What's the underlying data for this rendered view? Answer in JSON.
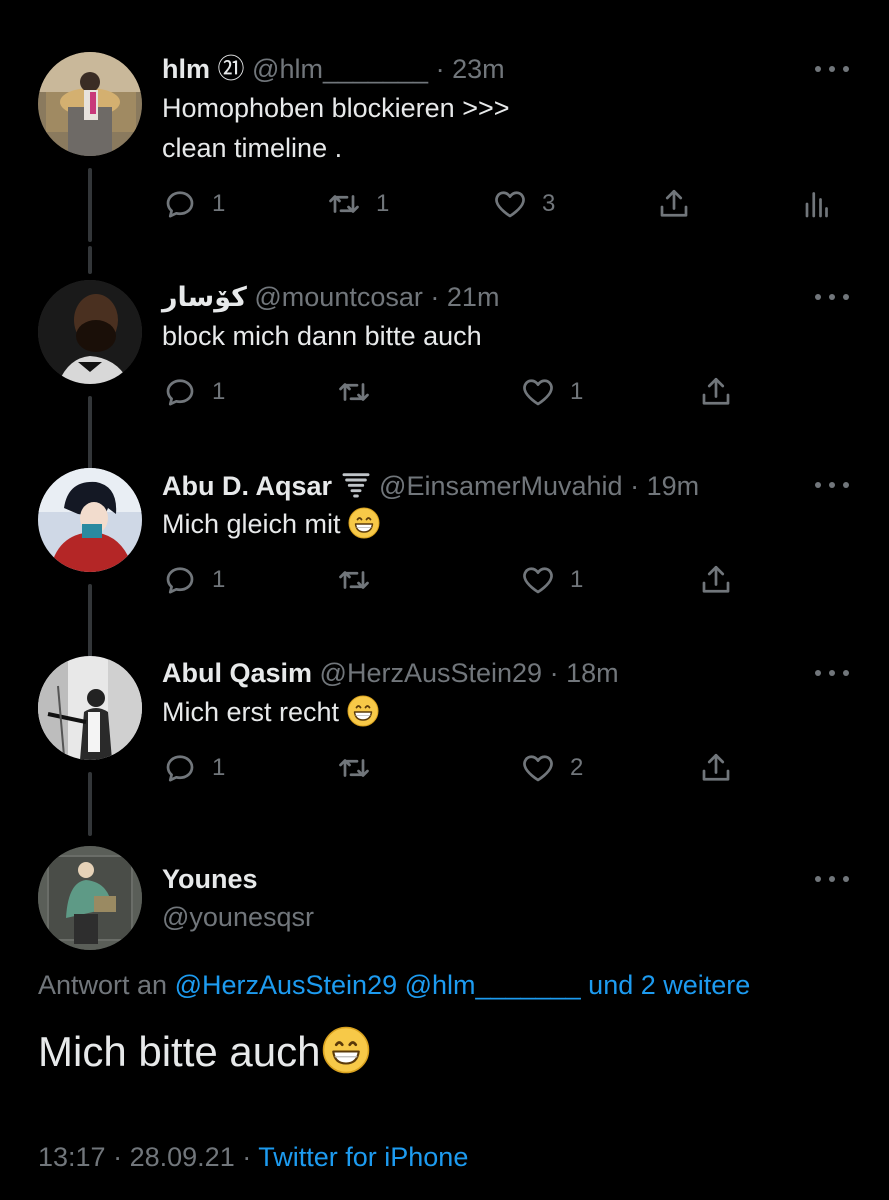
{
  "tweets": [
    {
      "name": "hlm",
      "badge": "㉑",
      "handle": "@hlm_______",
      "time": "23m",
      "text_lines": [
        "Homophoben blockieren >>>",
        "clean timeline ."
      ],
      "replies": "1",
      "retweets": "1",
      "likes": "3"
    },
    {
      "name": "كۆسار",
      "handle": "@mountcosar",
      "time": "21m",
      "text": "block mich dann bitte auch",
      "replies": "1",
      "retweets": "",
      "likes": "1"
    },
    {
      "name": "Abu D. Aqsar",
      "handle": "@EinsamerMuvahid",
      "time": "19m",
      "text": "Mich gleich mit",
      "replies": "1",
      "retweets": "",
      "likes": "1"
    },
    {
      "name": "Abul Qasim",
      "handle": "@HerzAusStein29",
      "time": "18m",
      "text": "Mich erst recht",
      "replies": "1",
      "retweets": "",
      "likes": "2"
    }
  ],
  "main_tweet": {
    "name": "Younes",
    "handle": "@younesqsr",
    "reply_prefix": "Antwort an",
    "reply_to_1": "@HerzAusStein29",
    "reply_to_2": "@hlm_______",
    "reply_more": "und 2 weitere",
    "text": "Mich bitte auch",
    "time": "13:17",
    "date": "28.09.21",
    "source": "Twitter for iPhone"
  },
  "separator": "·",
  "icons": {
    "reply": "reply-icon",
    "retweet": "retweet-icon",
    "like": "heart-icon",
    "share": "share-icon",
    "analytics": "analytics-icon",
    "more": "more-icon",
    "emoji": "grinning-face-emoji",
    "tornado": "tornado-emoji"
  },
  "colors": {
    "background": "#000000",
    "text": "#e7e9ea",
    "secondary": "#71767b",
    "link": "#1d9bf0"
  }
}
